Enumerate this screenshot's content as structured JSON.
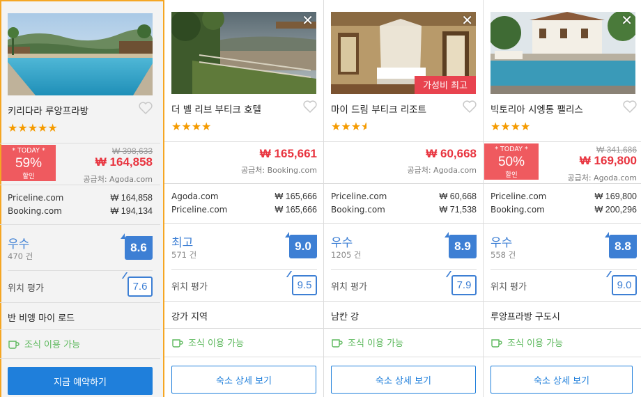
{
  "colors": {
    "accent": "#1f7fdb",
    "price": "#e8343f",
    "discount_bg": "#ef5a5f",
    "score": "#3d7fd4",
    "star": "#f59b00",
    "breakfast": "#5cb85c",
    "selected_border": "#f5a623"
  },
  "hotels": [
    {
      "name": "키리다라 루앙프라방",
      "stars": "★★★★★",
      "discount": {
        "today": "* TODAY *",
        "percent": "59%",
        "label": "할인"
      },
      "original_price": "₩ 398,633",
      "price": "₩ 164,858",
      "supplier": "공급처: Agoda.com",
      "providers": [
        {
          "name": "Priceline.com",
          "price": "₩ 164,858"
        },
        {
          "name": "Booking.com",
          "price": "₩ 194,134"
        }
      ],
      "rating_word": "우수",
      "reviews": "470 건",
      "score": "8.6",
      "location_label": "위치 평가",
      "location_score": "7.6",
      "area": "반 비엥 마이 로드",
      "breakfast": "조식 이용 가능",
      "button": "지금 예약하기"
    },
    {
      "name": "더 벨 리브 부티크 호텔",
      "stars": "★★★★",
      "price": "₩ 165,661",
      "supplier": "공급처: Booking.com",
      "providers": [
        {
          "name": "Agoda.com",
          "price": "₩ 165,666"
        },
        {
          "name": "Priceline.com",
          "price": "₩ 165,666"
        }
      ],
      "rating_word": "최고",
      "reviews": "571 건",
      "score": "9.0",
      "location_label": "위치 평가",
      "location_score": "9.5",
      "area": "강가 지역",
      "breakfast": "조식 이용 가능",
      "button": "숙소 상세 보기",
      "close": "✕"
    },
    {
      "name": "마이 드림 부티크 리조트",
      "stars": "★★★",
      "badge": "가성비 최고",
      "price": "₩ 60,668",
      "supplier": "공급처: Agoda.com",
      "providers": [
        {
          "name": "Priceline.com",
          "price": "₩ 60,668"
        },
        {
          "name": "Booking.com",
          "price": "₩ 71,538"
        }
      ],
      "rating_word": "우수",
      "reviews": "1205 건",
      "score": "8.9",
      "location_label": "위치 평가",
      "location_score": "7.9",
      "area": "남칸 강",
      "breakfast": "조식 이용 가능",
      "button": "숙소 상세 보기",
      "close": "✕"
    },
    {
      "name": "빅토리아 시엥통 팰리스",
      "stars": "★★★★",
      "discount": {
        "today": "* TODAY *",
        "percent": "50%",
        "label": "할인"
      },
      "original_price": "₩ 341,686",
      "price": "₩ 169,800",
      "supplier": "공급처: Agoda.com",
      "providers": [
        {
          "name": "Priceline.com",
          "price": "₩ 169,800"
        },
        {
          "name": "Booking.com",
          "price": "₩ 200,296"
        }
      ],
      "rating_word": "우수",
      "reviews": "558 건",
      "score": "8.8",
      "location_label": "위치 평가",
      "location_score": "9.0",
      "area": "루앙프라방 구도시",
      "breakfast": "조식 이용 가능",
      "button": "숙소 상세 보기",
      "close": "✕"
    }
  ]
}
